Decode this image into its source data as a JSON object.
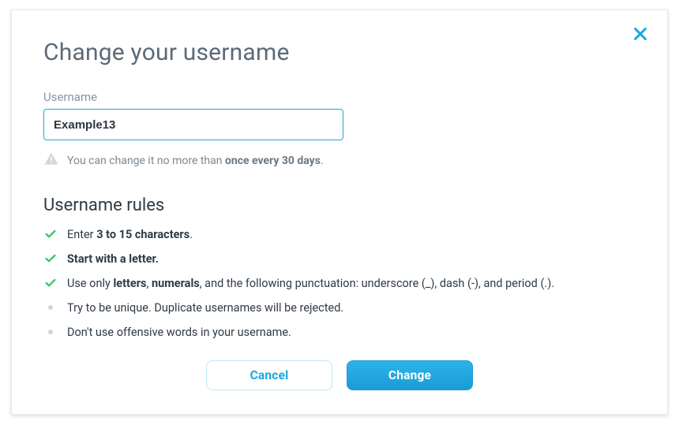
{
  "dialog": {
    "title": "Change your username",
    "close_label": "Close"
  },
  "field": {
    "label": "Username",
    "value": "Example13",
    "placeholder": ""
  },
  "notice": {
    "prefix": "You can change it no more than ",
    "bold": "once every 30 days",
    "suffix": "."
  },
  "rules": {
    "heading": "Username rules",
    "items": [
      {
        "icon": "check",
        "pre": "Enter ",
        "bold": "3 to 15 characters",
        "post": "."
      },
      {
        "icon": "check",
        "pre": "",
        "bold": "Start with a letter.",
        "post": ""
      },
      {
        "icon": "check",
        "pre": "Use only ",
        "bold": "letters",
        "mid1": ", ",
        "bold2": "numerals",
        "post": ", and the following punctuation: underscore (_), dash (-), and period (.)."
      },
      {
        "icon": "dot",
        "pre": "Try to be unique. Duplicate usernames will be rejected.",
        "bold": "",
        "post": ""
      },
      {
        "icon": "dot",
        "pre": "Don't use offensive words in your username.",
        "bold": "",
        "post": ""
      }
    ]
  },
  "buttons": {
    "cancel": "Cancel",
    "change": "Change"
  },
  "colors": {
    "accent": "#1ca7e0",
    "success": "#3bc46e",
    "muted": "#cfd6dc"
  }
}
